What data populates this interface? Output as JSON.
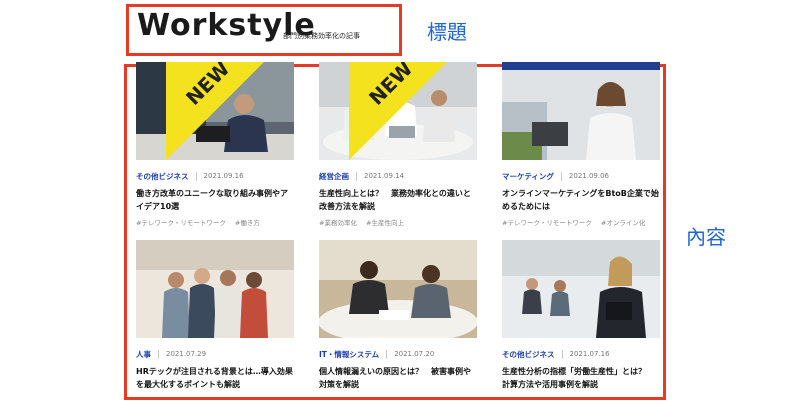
{
  "header": {
    "brand": "Workstyle",
    "subtitle": "部門別業務効率化の記事"
  },
  "annotations": {
    "title_label": "標題",
    "content_label": "內容"
  },
  "badge_text": "NEW",
  "accent_color": "#e53a23",
  "annotation_color": "#2166d0",
  "category_color": "#1d3fae",
  "articles": [
    {
      "category": "その他ビジネス",
      "date": "2021.09.16",
      "title": "働き方改革のユニークな取り組み事例やアイデア10選",
      "tags": [
        "#テレワーク・リモートワーク",
        "#働き方"
      ],
      "is_new": true
    },
    {
      "category": "経営企画",
      "date": "2021.09.14",
      "title": "生産性向上とは？　業務効率化との違いと改善方法を解説",
      "tags": [
        "#業務効率化",
        "#生産性向上"
      ],
      "is_new": true
    },
    {
      "category": "マーケティング",
      "date": "2021.09.06",
      "title": "オンラインマーケティングをBtoB企業で始めるためには",
      "tags": [
        "#テレワーク・リモートワーク",
        "#オンライン化"
      ],
      "is_new": false
    },
    {
      "category": "人事",
      "date": "2021.07.29",
      "title": "HRテックが注目される背景とは…導入効果を最大化するポイントも解説",
      "tags": [],
      "is_new": false
    },
    {
      "category": "IT・情報システム",
      "date": "2021.07.20",
      "title": "個人情報漏えいの原因とは？　被害事例や対策を解説",
      "tags": [],
      "is_new": false
    },
    {
      "category": "その他ビジネス",
      "date": "2021.07.16",
      "title": "生産性分析の指標「労働生産性」とは？　計算方法や活用事例を解説",
      "tags": [],
      "is_new": false
    }
  ]
}
